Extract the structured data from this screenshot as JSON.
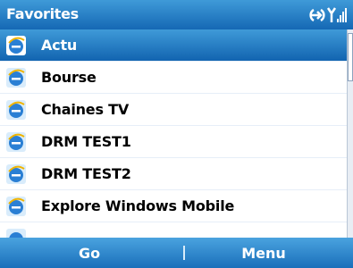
{
  "header": {
    "title": "Favorites"
  },
  "status_icons": [
    "connectivity-icon",
    "signal-strength-icon"
  ],
  "list": {
    "items": [
      {
        "label": "Actu",
        "icon": "internet-explorer-icon",
        "selected": true
      },
      {
        "label": "Bourse",
        "icon": "internet-explorer-icon",
        "selected": false
      },
      {
        "label": "Chaines TV",
        "icon": "internet-explorer-icon",
        "selected": false
      },
      {
        "label": "DRM TEST1",
        "icon": "internet-explorer-icon",
        "selected": false
      },
      {
        "label": "DRM TEST2",
        "icon": "internet-explorer-icon",
        "selected": false
      },
      {
        "label": "Explore Windows Mobile",
        "icon": "internet-explorer-icon",
        "selected": false
      }
    ]
  },
  "softkeys": {
    "left": "Go",
    "right": "Menu"
  },
  "colors": {
    "accent": "#1a6fba",
    "selection": "#3f9ad8"
  }
}
